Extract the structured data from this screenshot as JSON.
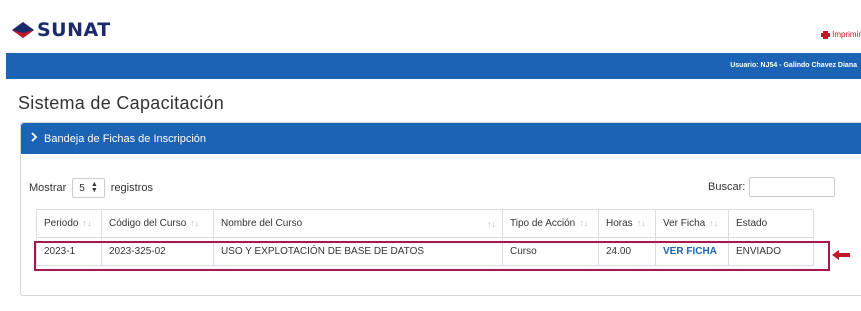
{
  "header": {
    "logo_text": "SUNAT",
    "print_label": "Imprimir",
    "user_label": "Usuario: NJ54 - Galindo Chavez Diana"
  },
  "page_title": "Sistema de Capacitación",
  "panel": {
    "title": "Bandeja de Fichas de Inscripción",
    "show_prefix": "Mostrar",
    "page_size": "5",
    "show_suffix": "registros",
    "search_label": "Buscar:",
    "search_value": ""
  },
  "table": {
    "headers": [
      "Periodo",
      "Código del Curso",
      "Nombre del Curso",
      "Tipo de Acción",
      "Horas",
      "Ver Ficha",
      "Estado"
    ],
    "rows": [
      [
        "2023-1",
        "2023-325-02",
        "USO Y EXPLOTACIÓN DE BASE DE DATOS",
        "Curso",
        "24.00",
        "VER FICHA",
        "ENVIADO"
      ]
    ]
  },
  "colors": {
    "brand_blue": "#1b63b5",
    "highlight": "#a8174f",
    "arrow": "#c0172b"
  }
}
